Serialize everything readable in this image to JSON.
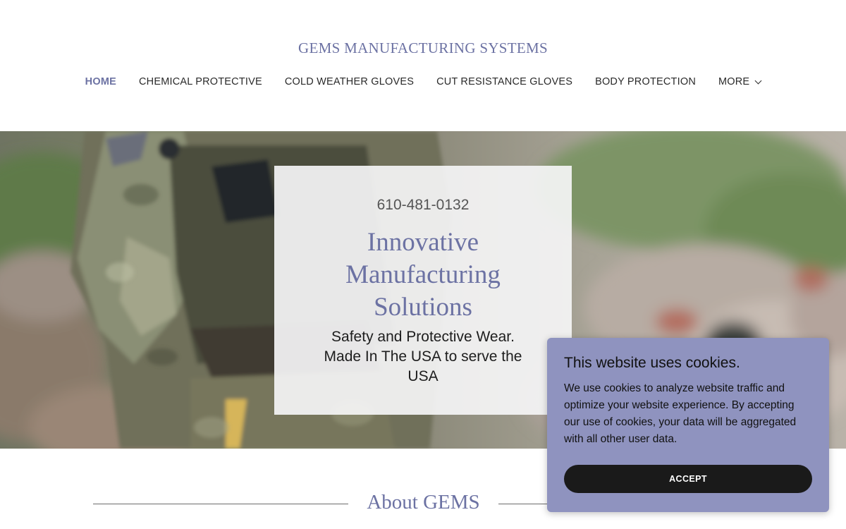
{
  "header": {
    "site_title": "GEMS MANUFACTURING SYSTEMS",
    "nav": [
      {
        "label": "HOME",
        "active": true
      },
      {
        "label": "CHEMICAL PROTECTIVE",
        "active": false
      },
      {
        "label": "COLD WEATHER GLOVES",
        "active": false
      },
      {
        "label": "CUT RESISTANCE GLOVES",
        "active": false
      },
      {
        "label": "BODY PROTECTION",
        "active": false
      },
      {
        "label": "MORE",
        "active": false,
        "icon": "chevron-down-icon"
      }
    ]
  },
  "hero": {
    "phone": "610-481-0132",
    "heading": "Innovative Manufacturing Solutions",
    "subheading": "Safety and Protective Wear. Made In The USA to serve the USA"
  },
  "about": {
    "title": "About GEMS"
  },
  "cookie_banner": {
    "title": "This website uses cookies.",
    "text": "We use cookies to analyze website traffic and optimize your website experience. By accepting our use of cookies, your data will be aggregated with all other user data.",
    "accept_label": "ACCEPT"
  },
  "colors": {
    "accent": "#6c72a3",
    "cookie_bg": "#8f93bf",
    "button_bg": "#1a1a1a"
  }
}
